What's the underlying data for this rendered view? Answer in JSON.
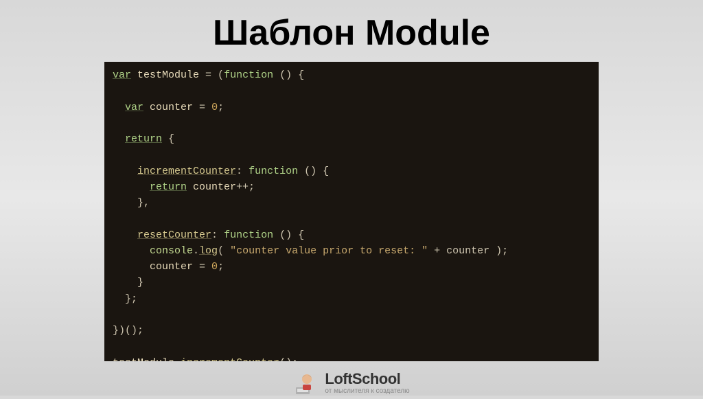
{
  "title": "Шаблон Module",
  "code": {
    "l1_var": "var",
    "l1_ident": " testModule ",
    "l1_eq": "= (",
    "l1_fn": "function",
    "l1_rest": " () {",
    "l2_var": "var",
    "l2_ident": " counter ",
    "l2_eq": "= ",
    "l2_num": "0",
    "l2_semi": ";",
    "l3_ret": "return",
    "l3_brace": " {",
    "l4_key": "incrementCounter",
    "l4_colon": ": ",
    "l4_fn": "function",
    "l4_rest": " () {",
    "l5_ret": "return",
    "l5_ident": " counter",
    "l5_op": "++;",
    "l6": "},",
    "l7_key": "resetCounter",
    "l7_colon": ": ",
    "l7_fn": "function",
    "l7_rest": " () {",
    "l8_obj": "console",
    "l8_dot": ".",
    "l8_log": "log",
    "l8_open": "( ",
    "l8_str": "\"counter value prior to reset: \"",
    "l8_plus": " + counter );",
    "l9_ident": "counter ",
    "l9_eq": "= ",
    "l9_num": "0",
    "l9_semi": ";",
    "l10": "}",
    "l11": "};",
    "l12": "})();",
    "l13_ident": "testModule",
    "l13_dot": ".",
    "l13_meth": "incrementCounter",
    "l13_call": "();"
  },
  "logo": {
    "name": "LoftSchool",
    "tagline": "от мыслителя к создателю"
  }
}
